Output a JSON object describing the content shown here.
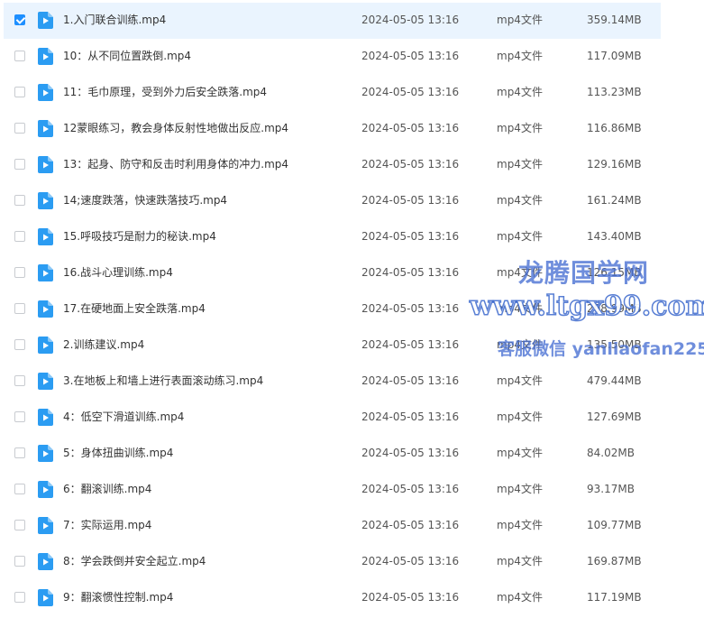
{
  "files": [
    {
      "name": "1.入门联合训练.mp4",
      "date": "2024-05-05 13:16",
      "type": "mp4文件",
      "size": "359.14MB",
      "selected": true
    },
    {
      "name": "10：从不同位置跌倒.mp4",
      "date": "2024-05-05 13:16",
      "type": "mp4文件",
      "size": "117.09MB",
      "selected": false
    },
    {
      "name": "11：毛巾原理，受到外力后安全跌落.mp4",
      "date": "2024-05-05 13:16",
      "type": "mp4文件",
      "size": "113.23MB",
      "selected": false
    },
    {
      "name": "12蒙眼练习，教会身体反射性地做出反应.mp4",
      "date": "2024-05-05 13:16",
      "type": "mp4文件",
      "size": "116.86MB",
      "selected": false
    },
    {
      "name": "13：起身、防守和反击时利用身体的冲力.mp4",
      "date": "2024-05-05 13:16",
      "type": "mp4文件",
      "size": "129.16MB",
      "selected": false
    },
    {
      "name": "14;速度跌落，快速跌落技巧.mp4",
      "date": "2024-05-05 13:16",
      "type": "mp4文件",
      "size": "161.24MB",
      "selected": false
    },
    {
      "name": "15.呼吸技巧是耐力的秘诀.mp4",
      "date": "2024-05-05 13:16",
      "type": "mp4文件",
      "size": "143.40MB",
      "selected": false
    },
    {
      "name": "16.战斗心理训练.mp4",
      "date": "2024-05-05 13:16",
      "type": "mp4文件",
      "size": "126.15MB",
      "selected": false
    },
    {
      "name": "17.在硬地面上安全跌落.mp4",
      "date": "2024-05-05 13:16",
      "type": "mp4文件",
      "size": "208.99MB",
      "selected": false
    },
    {
      "name": "2.训练建议.mp4",
      "date": "2024-05-05 13:16",
      "type": "mp4文件",
      "size": "135.50MB",
      "selected": false
    },
    {
      "name": "3.在地板上和墙上进行表面滚动练习.mp4",
      "date": "2024-05-05 13:16",
      "type": "mp4文件",
      "size": "479.44MB",
      "selected": false
    },
    {
      "name": "4：低空下滑道训练.mp4",
      "date": "2024-05-05 13:16",
      "type": "mp4文件",
      "size": "127.69MB",
      "selected": false
    },
    {
      "name": "5：身体扭曲训练.mp4",
      "date": "2024-05-05 13:16",
      "type": "mp4文件",
      "size": "84.02MB",
      "selected": false
    },
    {
      "name": "6：翻滚训练.mp4",
      "date": "2024-05-05 13:16",
      "type": "mp4文件",
      "size": "93.17MB",
      "selected": false
    },
    {
      "name": "7：实际运用.mp4",
      "date": "2024-05-05 13:16",
      "type": "mp4文件",
      "size": "109.77MB",
      "selected": false
    },
    {
      "name": "8：学会跌倒并安全起立.mp4",
      "date": "2024-05-05 13:16",
      "type": "mp4文件",
      "size": "169.87MB",
      "selected": false
    },
    {
      "name": "9：翻滚惯性控制.mp4",
      "date": "2024-05-05 13:16",
      "type": "mp4文件",
      "size": "117.19MB",
      "selected": false
    }
  ],
  "watermark": {
    "line1": "龙腾国学网",
    "line2": "www.ltgx99.com",
    "line3": "客服微信 yanliaofan225"
  },
  "colors": {
    "accent": "#1e8fff",
    "selected_row": "#eaf4fe",
    "video_icon": "#2b9cf2"
  },
  "icons": {
    "file_icon": "video-file-icon",
    "checkbox_checked": "checkmark-icon"
  }
}
